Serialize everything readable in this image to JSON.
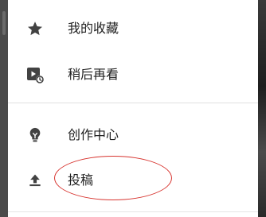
{
  "menu": {
    "items": [
      {
        "label": "我的收藏",
        "icon": "star-icon"
      },
      {
        "label": "稍后再看",
        "icon": "watch-later-icon"
      },
      {
        "label": "创作中心",
        "icon": "lightbulb-icon"
      },
      {
        "label": "投稿",
        "icon": "upload-icon"
      }
    ]
  },
  "colors": {
    "icon": "#424242",
    "text": "#212121",
    "annotation": "#d7332e"
  }
}
